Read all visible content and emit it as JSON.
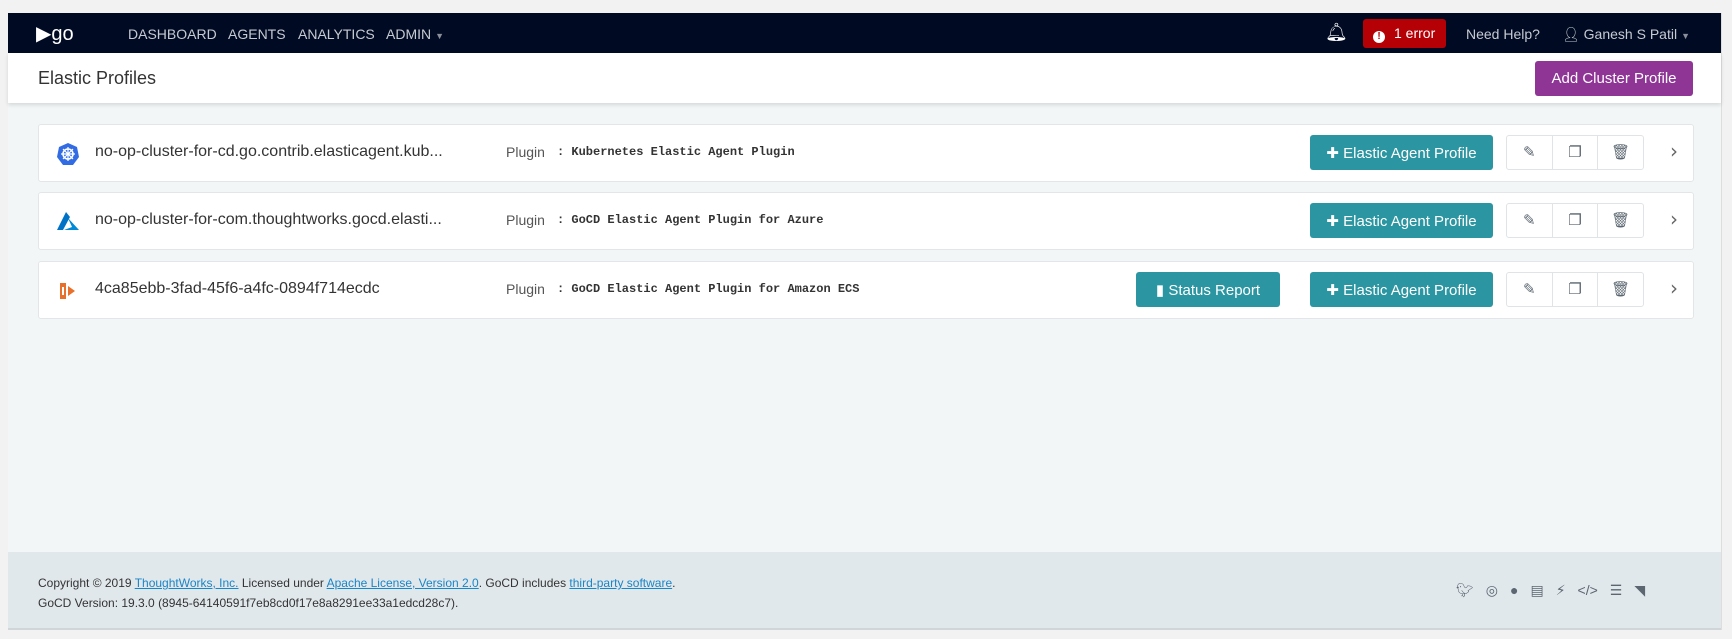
{
  "nav": {
    "logo": "go",
    "items": [
      "DASHBOARD",
      "AGENTS",
      "ANALYTICS",
      "ADMIN"
    ],
    "error_badge": "1 error",
    "help": "Need Help?",
    "user": "Ganesh S Patil"
  },
  "header": {
    "title": "Elastic Profiles",
    "add_button": "Add Cluster Profile"
  },
  "clusters": [
    {
      "name": "no-op-cluster-for-cd.go.contrib.elasticagent.kub...",
      "plugin_label": "Plugin",
      "plugin": ": Kubernetes Elastic Agent Plugin",
      "icon": "kubernetes-icon",
      "add_label": "Elastic Agent Profile"
    },
    {
      "name": "no-op-cluster-for-com.thoughtworks.gocd.elasti...",
      "plugin_label": "Plugin",
      "plugin": ": GoCD Elastic Agent Plugin for Azure",
      "icon": "azure-icon",
      "add_label": "Elastic Agent Profile"
    },
    {
      "name": "4ca85ebb-3fad-45f6-a4fc-0894f714ecdc",
      "plugin_label": "Plugin",
      "plugin": ": GoCD Elastic Agent Plugin for Amazon ECS",
      "icon": "ecs-icon",
      "add_label": "Elastic Agent Profile",
      "status_label": "Status Report"
    }
  ],
  "footer": {
    "copyright": "Copyright © 2019",
    "company": "ThoughtWorks, Inc.",
    "licensed": "Licensed under",
    "license": "Apache License, Version 2.0",
    "includes": ". GoCD includes",
    "third_party": "third-party software",
    "dot": ".",
    "version": "GoCD Version: 19.3.0 (8945-64140591f7eb8cd0f17e8a8291ee33a1edcd28c7)."
  },
  "colors": {
    "nav": "#000b23",
    "error": "#b50006",
    "primary": "#8e3596",
    "teal": "#2b96a1"
  }
}
